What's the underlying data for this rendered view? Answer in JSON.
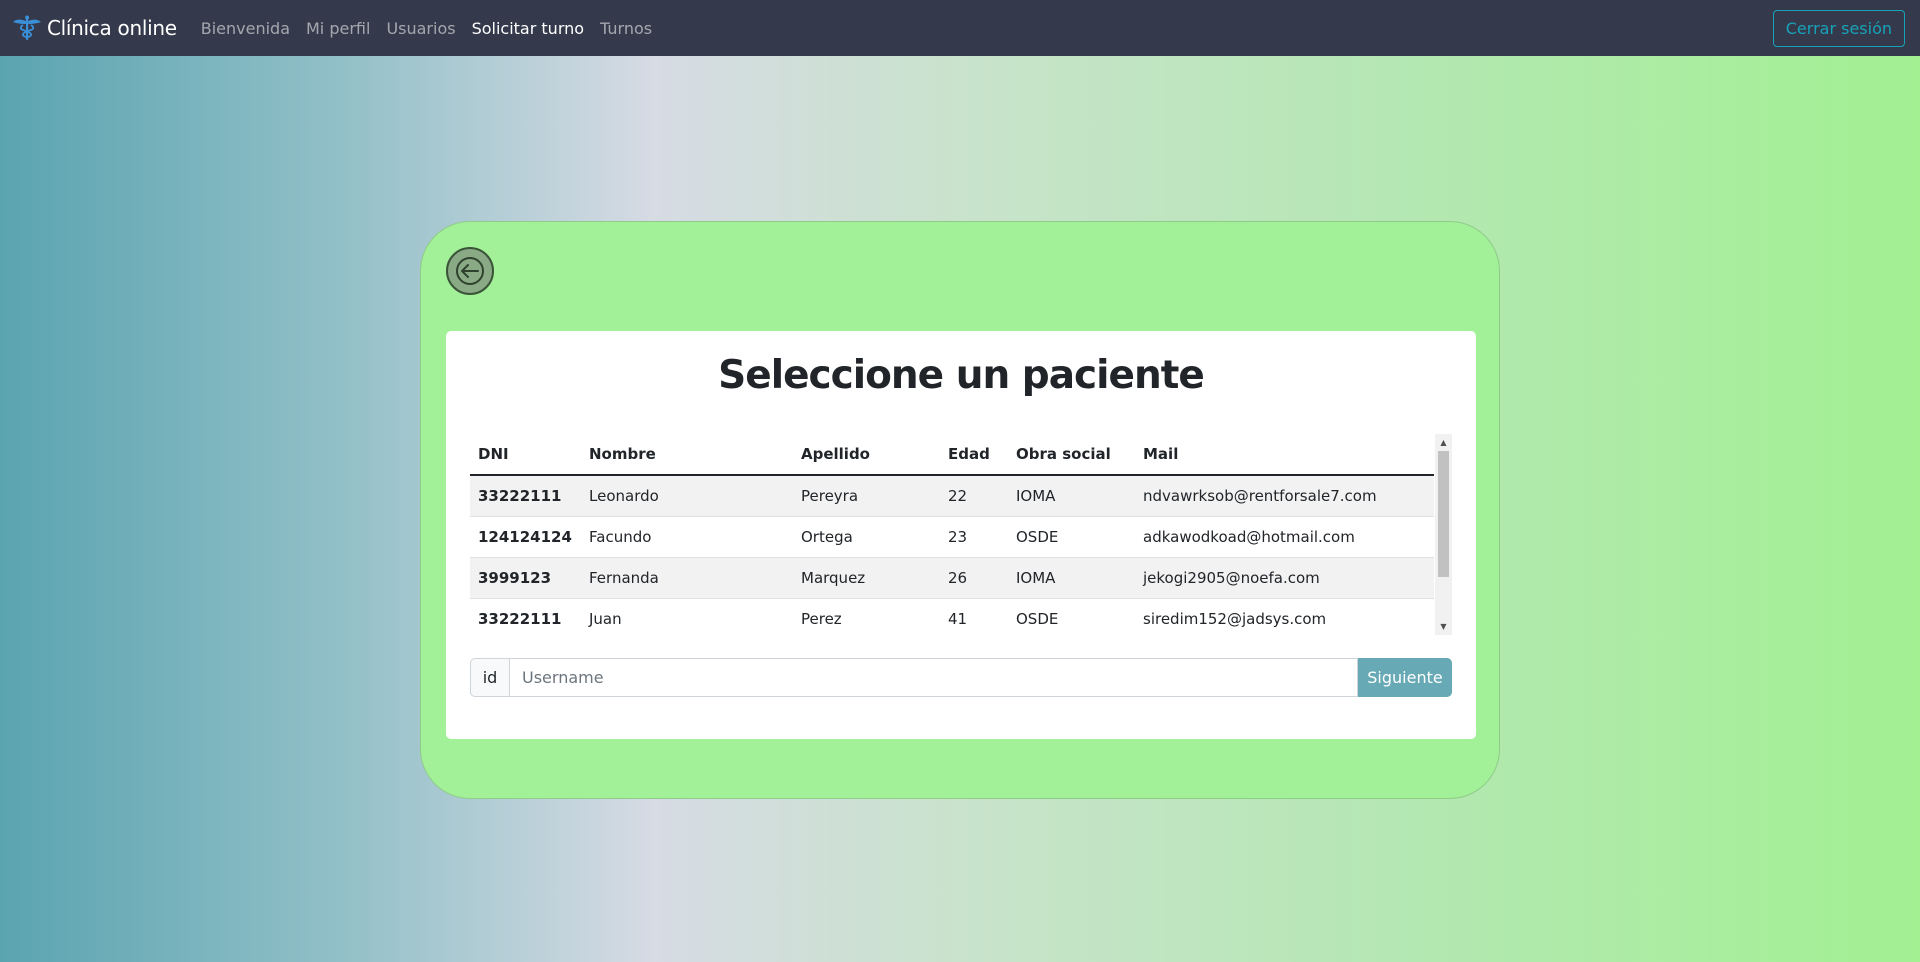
{
  "navbar": {
    "brand": "Clínica online",
    "links": [
      {
        "label": "Bienvenida",
        "active": false
      },
      {
        "label": "Mi perfil",
        "active": false
      },
      {
        "label": "Usuarios",
        "active": false
      },
      {
        "label": "Solicitar turno",
        "active": true
      },
      {
        "label": "Turnos",
        "active": false
      }
    ],
    "logout_label": "Cerrar sesión"
  },
  "card": {
    "back_icon": "arrow-left-icon",
    "title": "Seleccione un paciente",
    "table": {
      "headers": [
        "DNI",
        "Nombre",
        "Apellido",
        "Edad",
        "Obra social",
        "Mail"
      ],
      "rows": [
        [
          "33222111",
          "Leonardo",
          "Pereyra",
          "22",
          "IOMA",
          "ndvawrksob@rentforsale7.com"
        ],
        [
          "124124124",
          "Facundo",
          "Ortega",
          "23",
          "OSDE",
          "adkawodkoad@hotmail.com"
        ],
        [
          "3999123",
          "Fernanda",
          "Marquez",
          "26",
          "IOMA",
          "jekogi2905@noefa.com"
        ],
        [
          "33222111",
          "Juan",
          "Perez",
          "41",
          "OSDE",
          "siredim152@jadsys.com"
        ]
      ]
    },
    "input": {
      "prefix": "id",
      "placeholder": "Username",
      "value": "",
      "button_label": "Siguiente"
    }
  },
  "colors": {
    "navbar_bg": "#343a4b",
    "card_bg": "#a2f098",
    "accent_button": "#67a9b4",
    "logout_outline": "#17a2b8"
  }
}
